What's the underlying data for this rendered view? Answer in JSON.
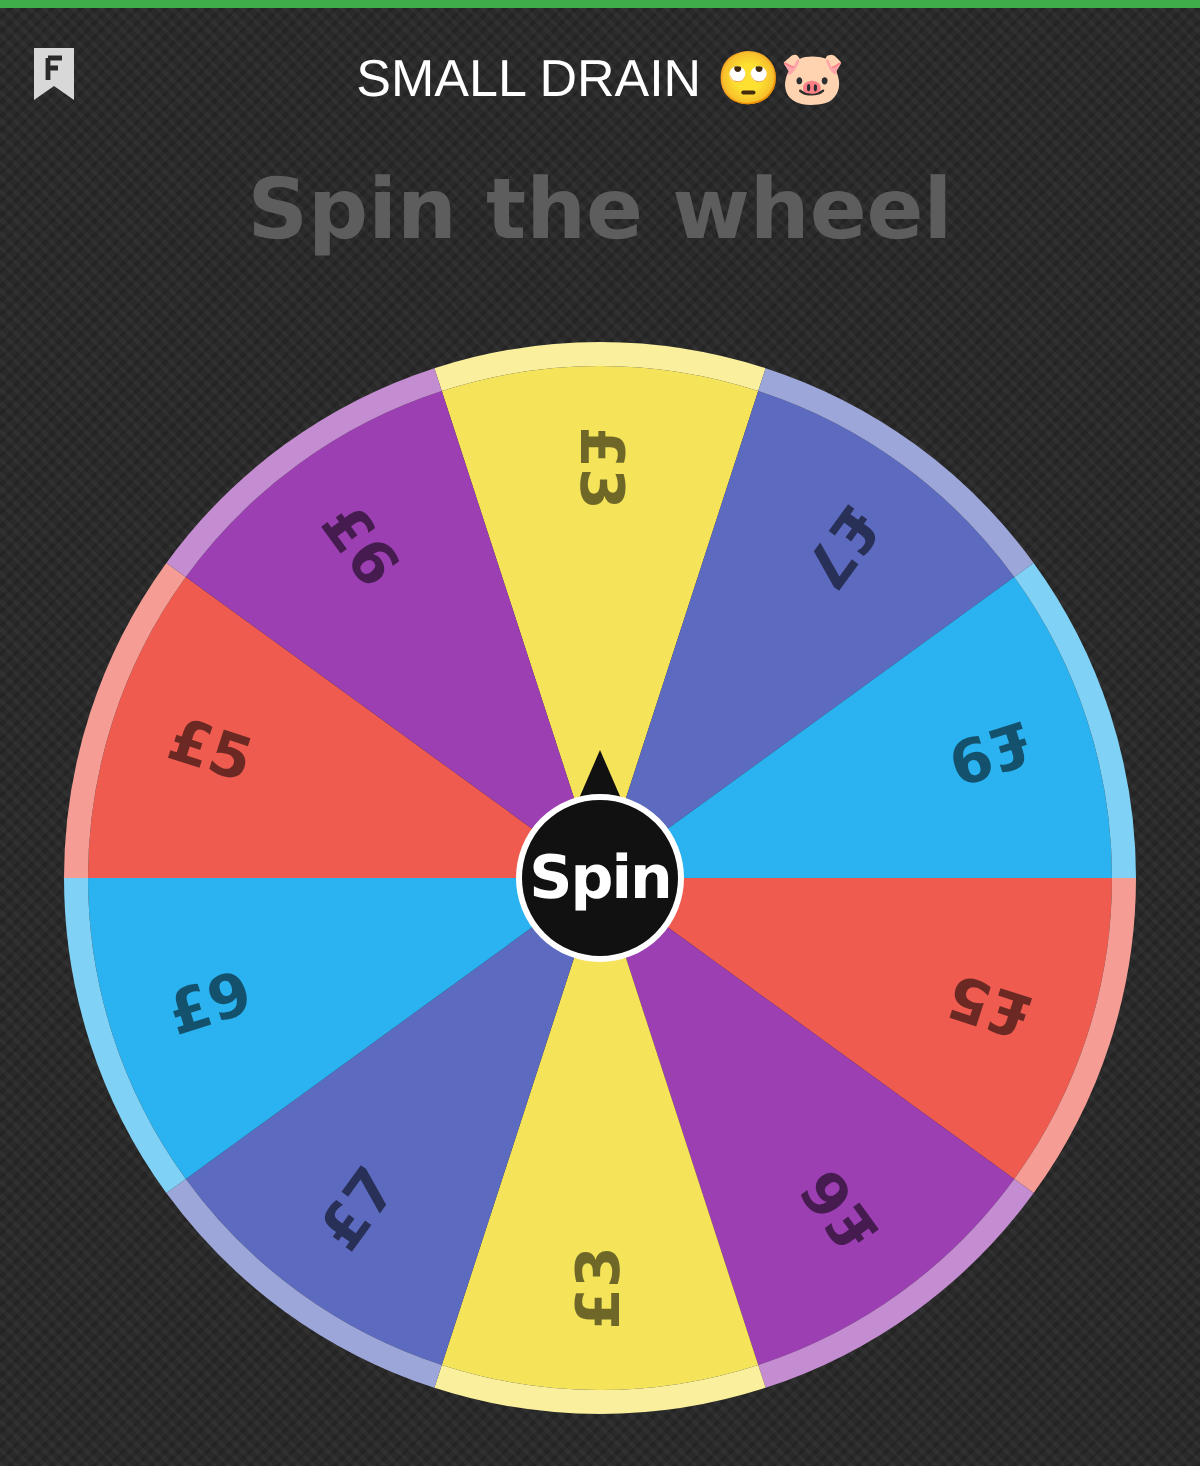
{
  "header": {
    "title": "SMALL DRAIN 🙄🐷"
  },
  "heading": "Spin the wheel",
  "wheel": {
    "segments": [
      {
        "label": "£3",
        "color": "#f5e45a"
      },
      {
        "label": "£7",
        "color": "#5c6bc0"
      },
      {
        "label": "£9",
        "color": "#2ab3f0"
      },
      {
        "label": "£5",
        "color": "#ef5b4f"
      },
      {
        "label": "£6",
        "color": "#9c3fb2"
      },
      {
        "label": "£3",
        "color": "#f5e45a"
      },
      {
        "label": "£7",
        "color": "#5c6bc0"
      },
      {
        "label": "£9",
        "color": "#2ab3f0"
      },
      {
        "label": "£5",
        "color": "#ef5b4f"
      },
      {
        "label": "£6",
        "color": "#9c3fb2"
      }
    ]
  },
  "spin_button": "Spin"
}
